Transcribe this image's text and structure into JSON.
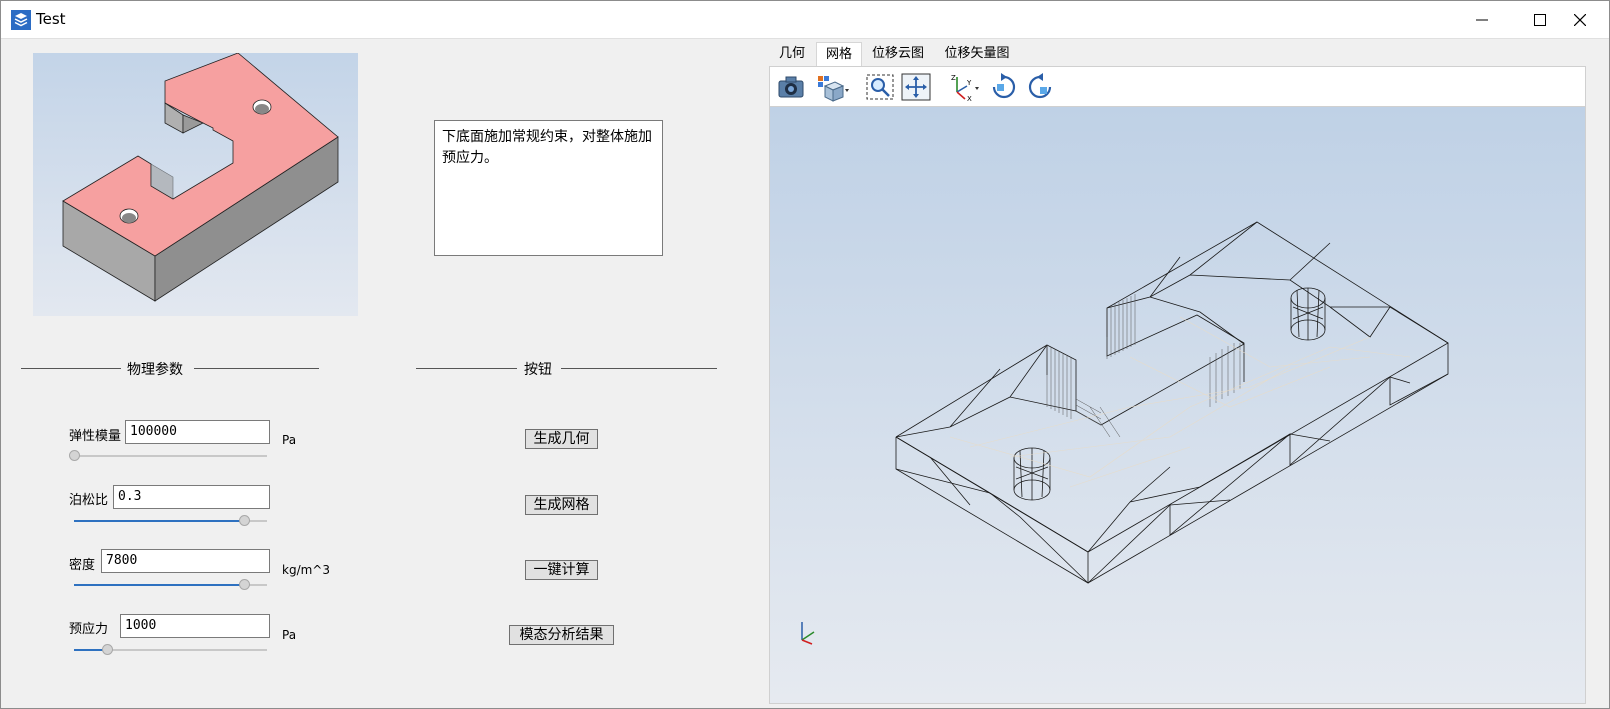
{
  "window": {
    "title": "Test",
    "controls": {
      "minimize": "minimize-icon",
      "maximize": "maximize-icon",
      "close": "close-icon"
    }
  },
  "left_panel": {
    "description": "下底面施加常规约束，对整体施加预应力。",
    "params_group_title": "物理参数",
    "buttons_group_title": "按钮",
    "params": [
      {
        "label": "弹性模量",
        "value": "100000",
        "unit": "Pa",
        "slider_fraction": 0.0
      },
      {
        "label": "泊松比",
        "value": "0.3",
        "unit": "",
        "slider_fraction": 0.88
      },
      {
        "label": "密度",
        "value": "7800",
        "unit": "kg/m^3",
        "slider_fraction": 0.88
      },
      {
        "label": "预应力",
        "value": "1000",
        "unit": "Pa",
        "slider_fraction": 0.17
      }
    ],
    "buttons": {
      "gen_geometry": "生成几何",
      "gen_mesh": "生成网格",
      "compute": "一键计算",
      "modal": "模态分析结果"
    }
  },
  "view_tabs": {
    "items": [
      "几何",
      "网格",
      "位移云图",
      "位移矢量图"
    ],
    "active": "网格"
  },
  "toolbar": {
    "icons": [
      "camera-icon",
      "view-cube-icon",
      "zoom-fit-icon",
      "pan-icon",
      "axes-icon",
      "rotate-cw-icon",
      "rotate-ccw-icon"
    ]
  },
  "colors": {
    "part_face": "#f6a0a0",
    "part_side": "#a8a8a8",
    "viewport_top": "#bfd1e6",
    "viewport_bottom": "#e6eaf0",
    "slider_fill": "#2e71c0"
  }
}
